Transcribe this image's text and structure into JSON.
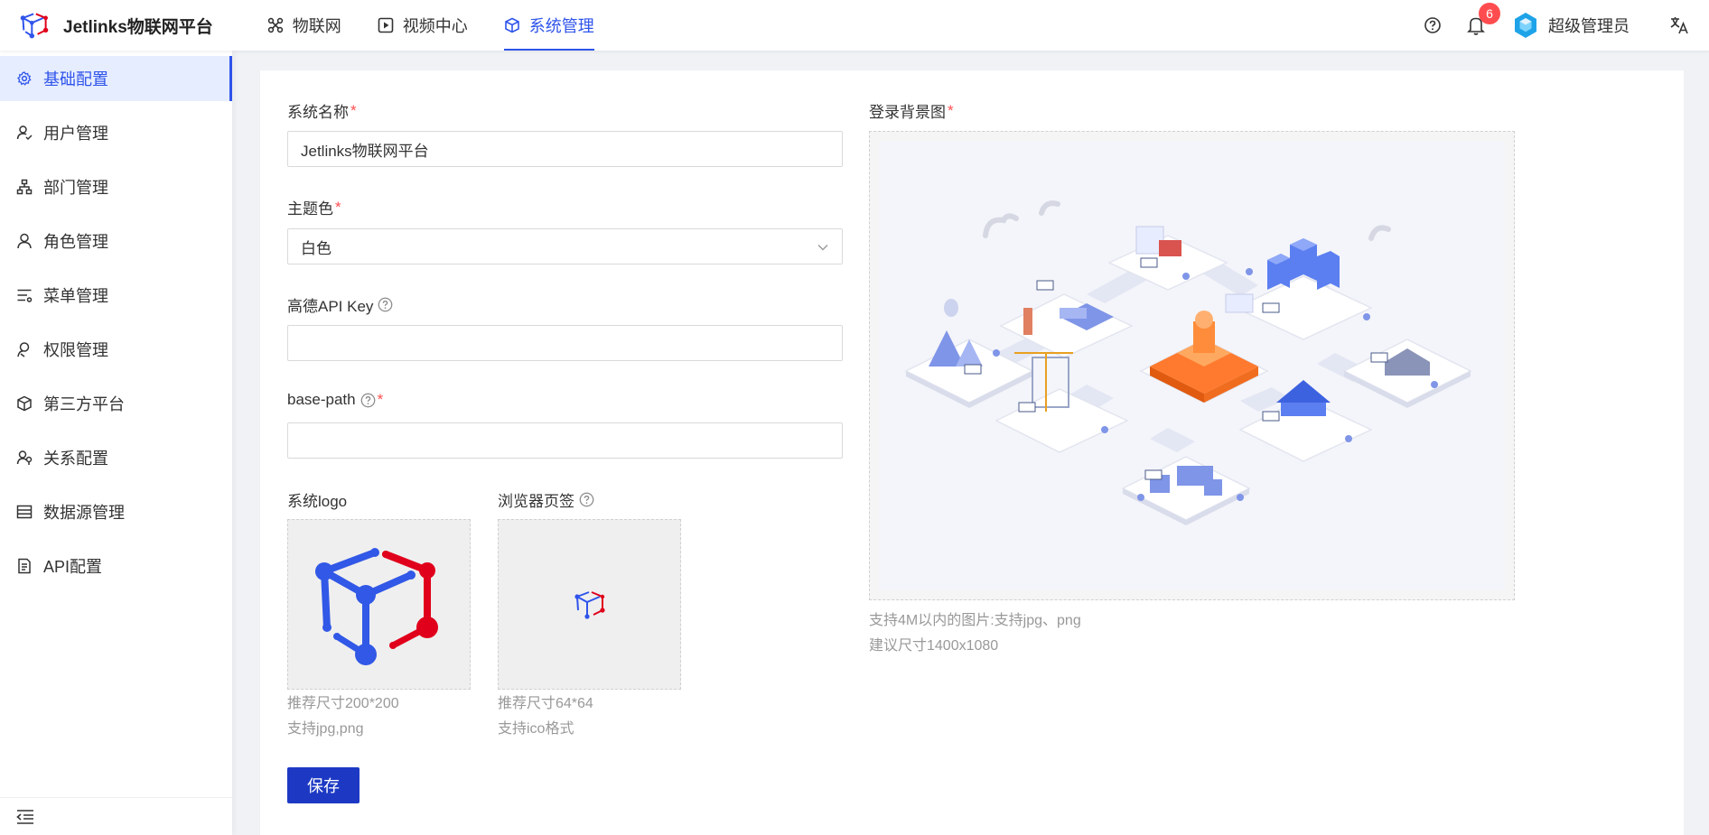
{
  "header": {
    "app_title": "Jetlinks物联网平台",
    "nav": [
      {
        "label": "物联网",
        "icon": "iot-icon"
      },
      {
        "label": "视频中心",
        "icon": "video-icon"
      },
      {
        "label": "系统管理",
        "icon": "system-icon",
        "active": true
      }
    ],
    "notification_count": "6",
    "user_name": "超级管理员"
  },
  "sidebar": {
    "items": [
      {
        "label": "基础配置",
        "icon": "gear-icon",
        "active": true
      },
      {
        "label": "用户管理",
        "icon": "user-icon"
      },
      {
        "label": "部门管理",
        "icon": "org-icon"
      },
      {
        "label": "角色管理",
        "icon": "role-icon"
      },
      {
        "label": "菜单管理",
        "icon": "menu-icon"
      },
      {
        "label": "权限管理",
        "icon": "permission-icon"
      },
      {
        "label": "第三方平台",
        "icon": "platform-icon"
      },
      {
        "label": "关系配置",
        "icon": "relation-icon"
      },
      {
        "label": "数据源管理",
        "icon": "database-icon"
      },
      {
        "label": "API配置",
        "icon": "api-icon"
      }
    ]
  },
  "form": {
    "system_name": {
      "label": "系统名称",
      "required": "*",
      "value": "Jetlinks物联网平台"
    },
    "theme": {
      "label": "主题色",
      "required": "*",
      "value": "白色"
    },
    "amap_key": {
      "label": "高德API Key",
      "value": ""
    },
    "base_path": {
      "label": "base-path",
      "required": "*",
      "value": ""
    },
    "logo": {
      "label": "系统logo",
      "hint1": "推荐尺寸200*200",
      "hint2": "支持jpg,png"
    },
    "favicon": {
      "label": "浏览器页签",
      "hint1": "推荐尺寸64*64",
      "hint2": "支持ico格式"
    },
    "login_bg": {
      "label": "登录背景图",
      "required": "*",
      "hint1": "支持4M以内的图片:支持jpg、png",
      "hint2": "建议尺寸1400x1080"
    },
    "save_label": "保存"
  },
  "colors": {
    "primary": "#2f54eb",
    "button": "#1d39c4",
    "logo_blue": "#2f54eb",
    "logo_red": "#e0001b"
  }
}
